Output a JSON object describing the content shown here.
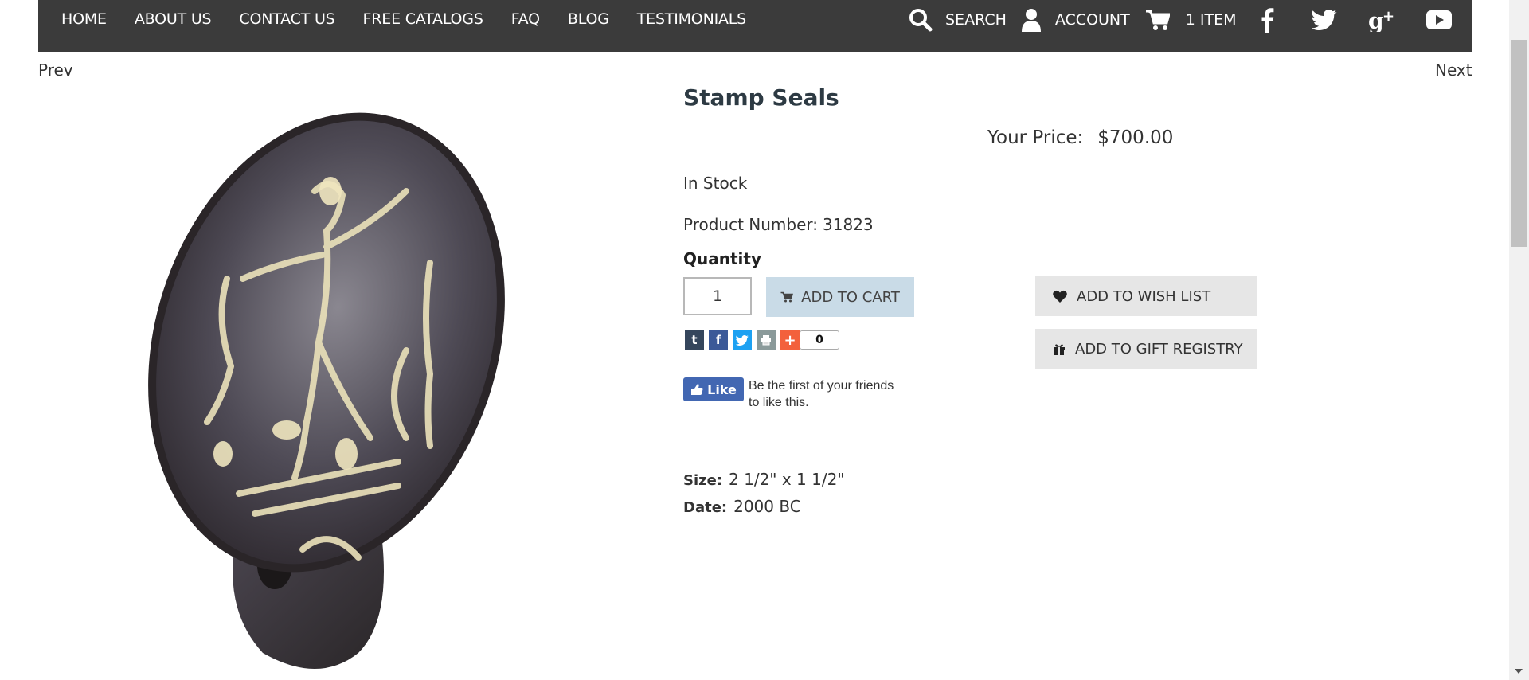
{
  "nav": {
    "links": [
      "HOME",
      "ABOUT US",
      "CONTACT US",
      "FREE CATALOGS",
      "FAQ",
      "BLOG",
      "TESTIMONIALS"
    ],
    "search_label": "SEARCH",
    "account_label": "ACCOUNT",
    "cart_label": "1 ITEM",
    "icons": [
      "search-icon",
      "user-icon",
      "cart-icon",
      "facebook-icon",
      "twitter-icon",
      "google-plus-icon",
      "youtube-icon"
    ]
  },
  "pager": {
    "prev": "Prev",
    "next": "Next"
  },
  "product": {
    "title": "Stamp Seals",
    "price_label": "Your Price:",
    "price": "$700.00",
    "stock": "In Stock",
    "number_label": "Product Number:",
    "number": "31823",
    "quantity_label": "Quantity",
    "quantity_value": "1",
    "add_to_cart": "ADD TO CART",
    "add_to_wishlist": "ADD TO WISH LIST",
    "add_to_gift_registry": "ADD TO GIFT REGISTRY",
    "share_count": "0",
    "fb_like": "Like",
    "fb_text": "Be the first of your friends to like this.",
    "specs": {
      "size_label": "Size:",
      "size": "2 1/2\" x 1 1/2\"",
      "date_label": "Date:",
      "date": "2000 BC"
    }
  },
  "colors": {
    "navbar": "#3b3b3b",
    "add_cart_bg": "#c9dbe7",
    "secondary_btn_bg": "#e6e6e6",
    "fb_blue": "#4267b2"
  }
}
